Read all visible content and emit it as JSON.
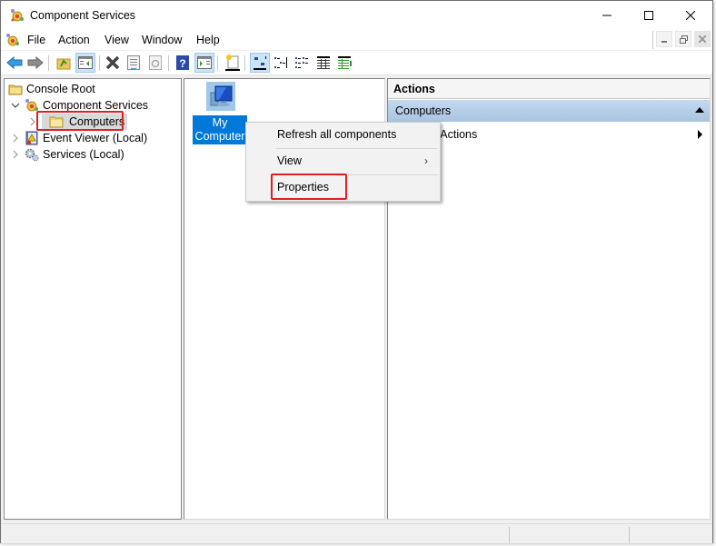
{
  "window": {
    "title": "Component Services",
    "icon": "component-services-icon"
  },
  "menubar": {
    "items": [
      "File",
      "Action",
      "View",
      "Window",
      "Help"
    ]
  },
  "toolbar": {
    "buttons": [
      {
        "name": "back",
        "icon": "arrow-left-icon"
      },
      {
        "name": "forward",
        "icon": "arrow-right-icon"
      },
      {
        "name": "up-one-level",
        "icon": "folder-up-icon"
      },
      {
        "name": "show-hide-console-tree",
        "icon": "console-tree-icon",
        "active": true
      },
      {
        "name": "delete",
        "icon": "delete-x-icon"
      },
      {
        "name": "properties",
        "icon": "properties-icon"
      },
      {
        "name": "refresh",
        "icon": "refresh-icon"
      },
      {
        "name": "help",
        "icon": "help-icon"
      },
      {
        "name": "show-hide-action-pane",
        "icon": "action-pane-icon",
        "active": true
      },
      {
        "name": "new",
        "icon": "new-item-icon"
      },
      {
        "name": "large-icons",
        "icon": "large-icons-view-icon",
        "active": true
      },
      {
        "name": "small-icons",
        "icon": "small-icons-view-icon"
      },
      {
        "name": "list",
        "icon": "list-view-icon"
      },
      {
        "name": "detail",
        "icon": "detail-view-icon"
      },
      {
        "name": "status-view",
        "icon": "status-view-icon"
      }
    ]
  },
  "tree": {
    "items": [
      {
        "label": "Console Root",
        "icon": "folder-icon",
        "level": 0,
        "expander": "none"
      },
      {
        "label": "Component Services",
        "icon": "component-services-icon",
        "level": 1,
        "expander": "expanded"
      },
      {
        "label": "Computers",
        "icon": "folder-icon",
        "level": 2,
        "expander": "collapsed",
        "selected": true,
        "highlighted": true
      },
      {
        "label": "Event Viewer (Local)",
        "icon": "event-viewer-icon",
        "level": 1,
        "expander": "collapsed"
      },
      {
        "label": "Services (Local)",
        "icon": "services-gear-icon",
        "level": 1,
        "expander": "collapsed"
      }
    ]
  },
  "center": {
    "item_label": "My Computer",
    "item_icon": "my-computer-icon"
  },
  "context_menu": {
    "items": [
      {
        "label": "Refresh all components",
        "submenu": false
      },
      {
        "label": "View",
        "submenu": true
      },
      {
        "label": "Properties",
        "submenu": false,
        "highlighted": true
      }
    ]
  },
  "actions": {
    "header": "Actions",
    "section_title": "Computers",
    "items": [
      {
        "label": "More Actions",
        "submenu": true
      }
    ]
  },
  "colors": {
    "highlight_red": "#e02020",
    "selection_blue": "#0078d7",
    "section_blue": "#b6cfe9"
  }
}
